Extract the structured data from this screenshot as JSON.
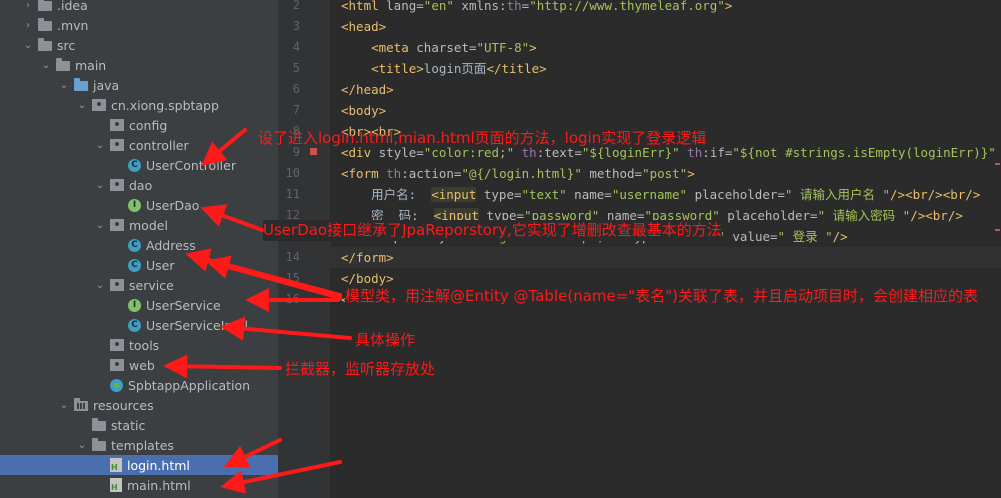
{
  "tree": {
    "items": [
      {
        "label": ".idea",
        "chev": "›",
        "icon": "folder"
      },
      {
        "label": ".mvn",
        "chev": "›",
        "icon": "folder"
      },
      {
        "label": "src",
        "chev": "⌄",
        "icon": "folder"
      },
      {
        "label": "main",
        "chev": "⌄",
        "icon": "folder"
      },
      {
        "label": "java",
        "chev": "⌄",
        "icon": "folder-blue"
      },
      {
        "label": "cn.xiong.spbtapp",
        "chev": "⌄",
        "icon": "package"
      },
      {
        "label": "config",
        "chev": "",
        "icon": "package"
      },
      {
        "label": "controller",
        "chev": "⌄",
        "icon": "package"
      },
      {
        "label": "UserController",
        "chev": "",
        "icon": "class",
        "badge": "C"
      },
      {
        "label": "dao",
        "chev": "⌄",
        "icon": "package"
      },
      {
        "label": "UserDao",
        "chev": "",
        "icon": "interface",
        "badge": "I"
      },
      {
        "label": "model",
        "chev": "⌄",
        "icon": "package"
      },
      {
        "label": "Address",
        "chev": "",
        "icon": "class",
        "badge": "C"
      },
      {
        "label": "User",
        "chev": "",
        "icon": "class",
        "badge": "C"
      },
      {
        "label": "service",
        "chev": "⌄",
        "icon": "package"
      },
      {
        "label": "UserService",
        "chev": "",
        "icon": "interface",
        "badge": "I"
      },
      {
        "label": "UserServiceImpl",
        "chev": "",
        "icon": "class",
        "badge": "C"
      },
      {
        "label": "tools",
        "chev": "",
        "icon": "package"
      },
      {
        "label": "web",
        "chev": "",
        "icon": "package"
      },
      {
        "label": "SpbtappApplication",
        "chev": "",
        "icon": "spring"
      },
      {
        "label": "resources",
        "chev": "⌄",
        "icon": "resources"
      },
      {
        "label": "static",
        "chev": "",
        "icon": "folder"
      },
      {
        "label": "templates",
        "chev": "⌄",
        "icon": "folder"
      },
      {
        "label": "login.html",
        "chev": "",
        "icon": "html",
        "badge": "H",
        "selected": true
      },
      {
        "label": "main.html",
        "chev": "",
        "icon": "html",
        "badge": "H"
      }
    ]
  },
  "editor": {
    "line_numbers": [
      "2",
      "3",
      "4",
      "5",
      "6",
      "7",
      "8",
      "9",
      "10",
      "11",
      "12",
      "13",
      "14",
      "15",
      "16"
    ],
    "lines": [
      "<html lang=\"en\" xmlns:th=\"http://www.thymeleaf.org\">",
      "<head>",
      "    <meta charset=\"UTF-8\">",
      "    <title>login页面</title>",
      "</head>",
      "<body>",
      "<br><br>",
      "<div style=\"color:red;\" th:text=\"${loginErr}\" th:if=\"${not #strings.isEmpty(loginErr)}\"",
      "<form th:action=\"@{/login.html}\" method=\"post\">",
      "    用户名:  <input type=\"text\" name=\"username\" placeholder=\" 请输入用户名 \"/><br/><br/>",
      "    密  码:  <input type=\"password\" name=\"password\" placeholder=\" 请输入密码 \"/><br/>",
      "    <input style=\"margin-left:60px;\"  type=\"submit\" value=\" 登录 \"/>",
      "</form>",
      "</body>",
      "</html>"
    ]
  },
  "annotations": {
    "controller": "设了进入login.html,mian.html页面的方法，login实现了登录逻辑",
    "dao": "UserDao接口继承了JpaReporstory,它实现了增删改查最基本的方法",
    "model": "模型类，用注解@Entity @Table(name=\"表名\")关联了表，并且启动项目时，会创建相应的表",
    "service": "具体操作",
    "web": "拦截器，监听器存放处"
  },
  "colors": {
    "annotation": "#ff1a1a",
    "selection": "#4b6eaf",
    "tag": "#e8bf6a",
    "string": "#a5c25c"
  }
}
